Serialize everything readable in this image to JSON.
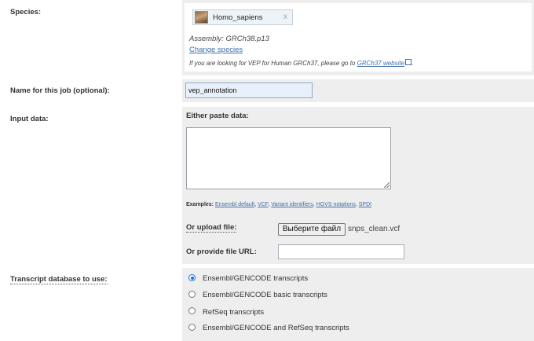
{
  "species": {
    "label": "Species:",
    "selected": "Homo_sapiens",
    "remove": "x",
    "assembly": "Assembly: GRCh38.p13",
    "change_link": "Change species",
    "grch37_note_prefix": "If you are looking for VEP for Human GRCh37, please go to ",
    "grch37_link": "GRCh37 website",
    "grch37_note_suffix": "."
  },
  "job_name": {
    "label": "Name for this job (optional):",
    "value": "vep_annotation"
  },
  "input_data": {
    "label": "Input data:",
    "paste_label": "Either paste data:",
    "textarea_value": "",
    "examples_label": "Examples:",
    "examples": [
      "Ensembl default",
      "VCF",
      "Variant identifiers",
      "HGVS notations",
      "SPDI"
    ],
    "upload_label": "Or upload file:",
    "upload_button": "Выберите файл",
    "upload_filename": "snps_clean.vcf",
    "url_label": "Or provide file URL:",
    "url_value": ""
  },
  "transcript_db": {
    "label": "Transcript database to use:",
    "options": [
      {
        "label": "Ensembl/GENCODE transcripts",
        "selected": true
      },
      {
        "label": "Ensembl/GENCODE basic transcripts",
        "selected": false
      },
      {
        "label": "RefSeq transcripts",
        "selected": false
      },
      {
        "label": "Ensembl/GENCODE and RefSeq transcripts",
        "selected": false
      }
    ]
  },
  "colors": {
    "panel_bg": "#eeeeee",
    "link": "#3e6da8",
    "radio_selected": "#1a6fd1"
  }
}
